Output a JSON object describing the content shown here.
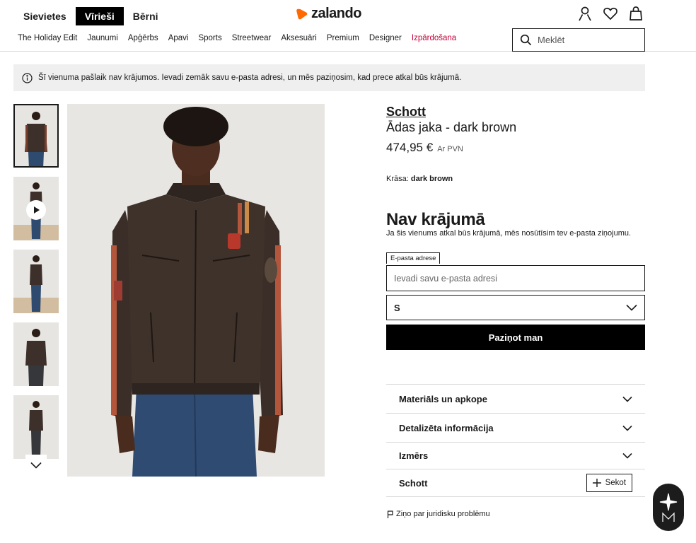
{
  "header": {
    "gender_tabs": [
      "Sievietes",
      "Vīrieši",
      "Bērni"
    ],
    "active_gender": "Vīrieši",
    "logo": "zalando",
    "brand_color": "#ff6900"
  },
  "nav": {
    "items": [
      "The Holiday Edit",
      "Jaunumi",
      "Apģērbs",
      "Apavi",
      "Sports",
      "Streetwear",
      "Aksesuāri",
      "Premium",
      "Designer",
      "Izpārdošana"
    ],
    "sale_color": "#c4003a"
  },
  "search": {
    "placeholder": "Meklēt"
  },
  "notice": {
    "text": "Šī vienuma pašlaik nav krājumos. Ievadi zemāk savu e-pasta adresi, un mēs paziņosim, kad prece atkal būs krājumā."
  },
  "product": {
    "brand": "Schott",
    "name": "Ādas jaka - dark brown",
    "price": "474,95 €",
    "vat": "Ar PVN",
    "color_label": "Krāsa:",
    "color_value": "dark brown"
  },
  "stock": {
    "title": "Nav krājumā",
    "subtitle": "Ja šis vienums atkal būs krājumā, mēs nosūtīsim tev e-pasta ziņojumu.",
    "email_label": "E-pasta adrese",
    "email_placeholder": "Ievadi savu e-pasta adresi",
    "size": "S",
    "notify_button": "Paziņot man"
  },
  "accordions": [
    {
      "label": "Materiāls un apkope"
    },
    {
      "label": "Detalizēta informācija"
    },
    {
      "label": "Izmērs"
    }
  ],
  "brand_follow": {
    "label": "Schott",
    "button": "Sekot"
  },
  "report": "Ziņo par juridisku problēmu"
}
